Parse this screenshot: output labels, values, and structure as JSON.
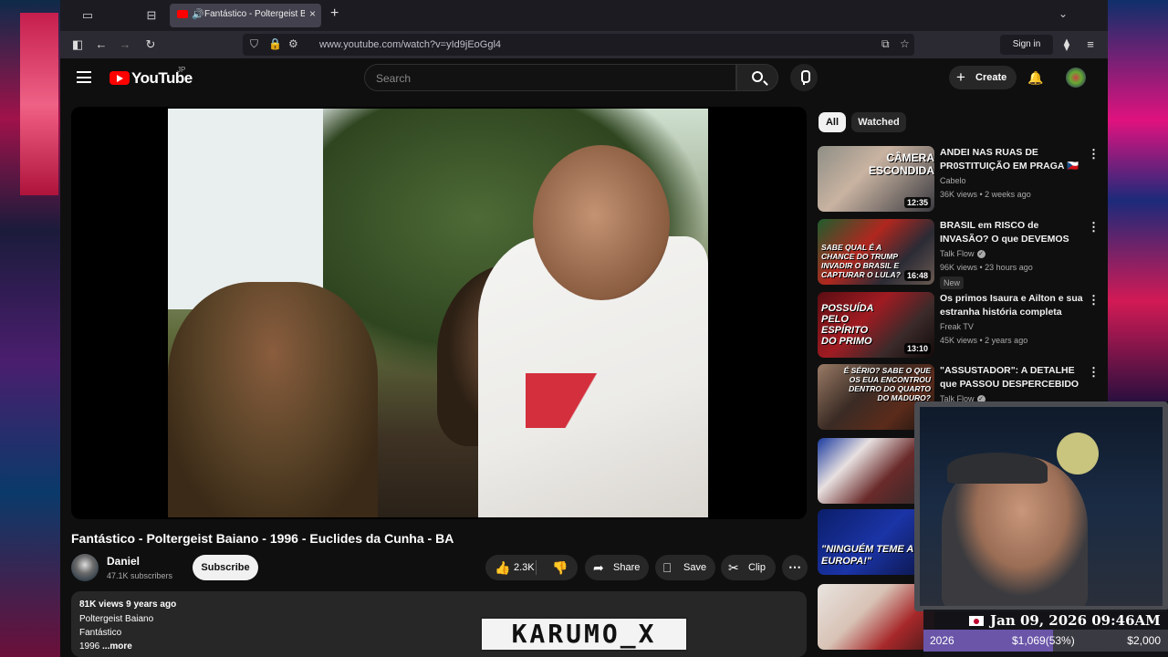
{
  "browser": {
    "tab_title": "Fantástico - Poltergeist Baiano",
    "url": "www.youtube.com/watch?v=yId9jEoGgl4",
    "sign_in": "Sign in",
    "close_glyph": "×",
    "new_tab_glyph": "+"
  },
  "youtube": {
    "logo_text": "YouTube",
    "region": "JP",
    "search_placeholder": "Search",
    "create_label": "Create",
    "brand_color": "#ff0000"
  },
  "video": {
    "title": "Fantástico - Poltergeist Baiano - 1996 - Euclides da Cunha - BA",
    "channel": "Daniel",
    "subscribers": "47.1K subscribers",
    "subscribe_label": "Subscribe",
    "likes": "2.3K",
    "share_label": "Share",
    "save_label": "Save",
    "clip_label": "Clip",
    "description": {
      "meta": "81K views  9 years ago",
      "line1": "Poltergeist Baiano",
      "line2": "Fantástico",
      "line3": "1996",
      "more": "...more"
    }
  },
  "filters": {
    "all": "All",
    "watched": "Watched"
  },
  "recommendations": [
    {
      "title": "ANDEI NAS RUAS DE PR0STITUIÇÃO EM PRAGA 🇨🇿",
      "channel": "Cabelo",
      "verified": false,
      "meta": "36K views • 2 weeks ago",
      "duration": "12:35",
      "thumb_text": "CÂMERA ESCONDIDA",
      "badge": ""
    },
    {
      "title": "BRASIL em RISCO de INVASÃO? O que DEVEMOS ESPERAR ...",
      "channel": "Talk Flow",
      "verified": true,
      "meta": "96K views • 23 hours ago",
      "duration": "16:48",
      "thumb_text": "SABE QUAL É A CHANCE DO TRUMP INVADIR O BRASIL E CAPTURAR O LULA?",
      "badge": "New"
    },
    {
      "title": "Os primos Isaura e Ailton e sua estranha história completa",
      "channel": "Freak TV",
      "verified": false,
      "meta": "45K views • 2 years ago",
      "duration": "13:10",
      "thumb_text": "POSSUÍDA PELO ESPÍRITO DO PRIMO",
      "badge": ""
    },
    {
      "title": "\"ASSUSTADOR\": A DETALHE que PASSOU DESPERCEBIDO ...",
      "channel": "Talk Flow",
      "verified": true,
      "meta": "",
      "duration": "",
      "thumb_text": "É SÉRIO? SABE O QUE OS EUA ENCONTROU DENTRO DO QUARTO DO MADURO?",
      "badge": ""
    },
    {
      "title": "",
      "channel": "",
      "verified": false,
      "meta": "",
      "duration": "",
      "thumb_text": "",
      "badge": ""
    },
    {
      "title": "",
      "channel": "",
      "verified": false,
      "meta": "",
      "duration": "",
      "thumb_text": "\"NINGUÉM TEME A EUROPA!\"",
      "badge": ""
    },
    {
      "title": "",
      "channel": "",
      "verified": false,
      "meta": "",
      "duration": "",
      "thumb_text": "",
      "badge": ""
    }
  ],
  "overlay": {
    "streamer_name": "KARUMO_X",
    "date": "Jan 09, 2026 09:46AM",
    "goal_year": "2026",
    "goal_amount": "$1,069(53%)",
    "goal_target": "$2,000",
    "goal_fraction": 0.53,
    "goal_color": "#6a55a8"
  }
}
